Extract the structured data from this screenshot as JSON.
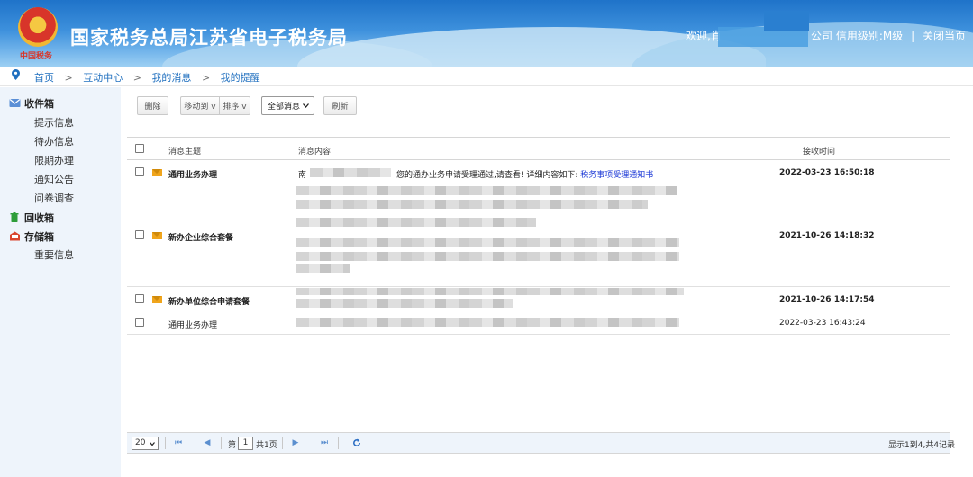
{
  "header": {
    "title": "国家税务总局江苏省电子税务局",
    "logo_text": "中国税务",
    "welcome": "欢迎,肖",
    "company_suffix": "公司",
    "credit_level": "信用级别:M级",
    "separator": "|",
    "close_page": "关闭当页"
  },
  "breadcrumb": {
    "items": [
      "首页",
      "互动中心",
      "我的消息",
      "我的提醒"
    ],
    "separator": ">"
  },
  "sidebar": {
    "inbox": "收件箱",
    "inbox_items": [
      "提示信息",
      "待办信息",
      "限期办理",
      "通知公告",
      "问卷调查"
    ],
    "recycle": "回收箱",
    "storage": "存储箱",
    "storage_items": [
      "重要信息"
    ],
    "colors": {
      "background": "#eef4fb",
      "inbox_icon": "#5b8fd6",
      "recycle_icon": "#2e9d3a",
      "storage_icon": "#d9462f"
    }
  },
  "toolbar": {
    "delete": "删除",
    "move_to": "移动到 v",
    "sort": "排序 v",
    "filter_selected": "全部消息",
    "refresh": "刷新"
  },
  "table": {
    "headers": {
      "subject": "消息主题",
      "content": "消息内容",
      "received": "接收时间"
    },
    "rows": [
      {
        "subject": "通用业务办理",
        "content_prefix": "南",
        "content_text": "您的通办业务申请受理通过,请查看!  详细内容如下:",
        "content_link": "税务事项受理通知书",
        "time": "2022-03-23 16:50:18",
        "unread": true
      },
      {
        "subject": "新办企业综合套餐",
        "time": "2021-10-26 14:18:32",
        "unread": true
      },
      {
        "subject": "新办单位综合申请套餐",
        "time": "2021-10-26 14:17:54",
        "unread": true
      },
      {
        "subject": "通用业务办理",
        "time": "2022-03-23 16:43:24",
        "unread": false
      }
    ]
  },
  "pager": {
    "page_size": "20",
    "page_label_before": "第",
    "page_value": "1",
    "page_label_after": "共1页",
    "summary": "显示1到4,共4记录"
  },
  "colors": {
    "link": "#1f6fbf",
    "header_blue": "#1f73c9",
    "mail_icon": "#f0a51c",
    "content_link": "#1a37d6"
  }
}
